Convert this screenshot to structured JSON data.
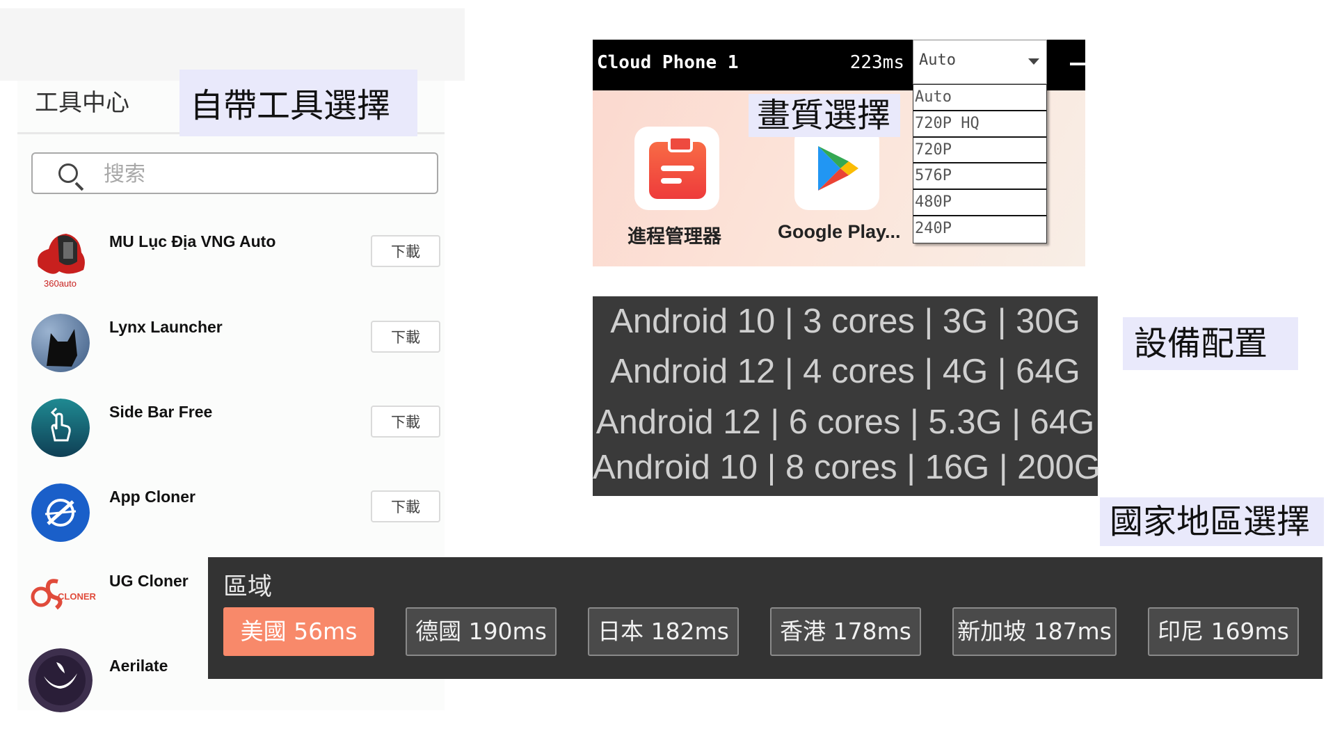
{
  "tool_center": {
    "title": "工具中心",
    "search_placeholder": "搜索",
    "download_label": "下載",
    "apps": [
      {
        "name": "MU Lục Địa VNG Auto",
        "badge": "360auto"
      },
      {
        "name": "Lynx Launcher"
      },
      {
        "name": "Side Bar Free"
      },
      {
        "name": "App Cloner"
      },
      {
        "name": "UG Cloner",
        "badge": "CLONER"
      },
      {
        "name": "Aerilate"
      }
    ]
  },
  "callouts": {
    "builtin_tools": "自帶工具選擇",
    "quality": "畫質選擇",
    "device_config": "設備配置",
    "region": "國家地區選擇"
  },
  "cloud_phone": {
    "title": "Cloud Phone 1",
    "latency": "223ms",
    "quality_selected": "Auto",
    "quality_options": [
      "Auto",
      "720P HQ",
      "720P",
      "576P",
      "480P",
      "240P"
    ],
    "apps": [
      {
        "name": "進程管理器",
        "icon": "clipboard-icon"
      },
      {
        "name": "Google Play...",
        "icon": "google-play-icon"
      }
    ]
  },
  "device_specs": [
    "Android 10 | 3 cores | 3G | 30G",
    "Android 12 | 4 cores | 4G | 64G",
    "Android 12 | 6 cores | 5.3G | 64G",
    "Android 10 | 8 cores | 16G | 200G"
  ],
  "region": {
    "label": "區域",
    "options": [
      {
        "name": "美國 56ms",
        "active": true
      },
      {
        "name": "德國 190ms"
      },
      {
        "name": "日本 182ms"
      },
      {
        "name": "香港 178ms"
      },
      {
        "name": "新加坡 187ms"
      },
      {
        "name": "印尼 169ms"
      }
    ]
  },
  "colors": {
    "accent": "#f8896a",
    "dark_panel": "#333333",
    "callout_bg": "#e9e9fb"
  }
}
